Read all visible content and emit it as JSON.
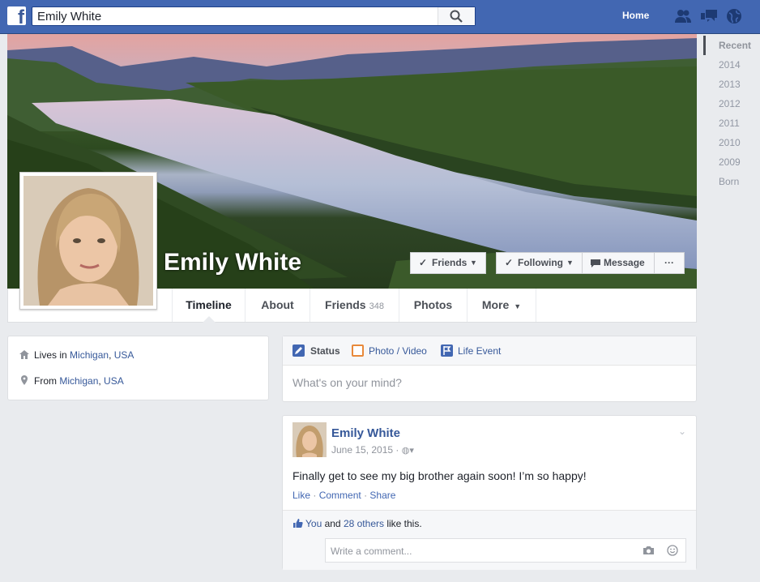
{
  "header": {
    "search_value": "Emily White",
    "home_label": "Home"
  },
  "timeline_nav": [
    "Recent",
    "2014",
    "2013",
    "2012",
    "2011",
    "2010",
    "2009",
    "Born"
  ],
  "profile": {
    "name": "Emily White"
  },
  "cover_buttons": {
    "friends": "Friends",
    "following": "Following",
    "message": "Message",
    "more": "···"
  },
  "tabs": {
    "timeline": "Timeline",
    "about": "About",
    "friends": "Friends",
    "friends_count": "348",
    "photos": "Photos",
    "more": "More"
  },
  "intro": {
    "lives_prefix": "Lives in ",
    "lives_city": "Michigan",
    "lives_sep": ", ",
    "lives_country": "USA",
    "from_prefix": "From ",
    "from_city": "Michigan",
    "from_sep": ", ",
    "from_country": "USA"
  },
  "composer": {
    "status": "Status",
    "photo_video": "Photo / Video",
    "life_event": "Life Event",
    "placeholder": "What's on your mind?"
  },
  "post": {
    "author": "Emily White",
    "date": "June 15, 2015 ·",
    "text": "Finally get to see my big brother again soon! I’m so happy!",
    "like": "Like",
    "comment": "Comment",
    "share": "Share",
    "likes_you": "You",
    "likes_and": " and ",
    "likes_others": "28 others",
    "likes_suffix": " like this.",
    "comment_placeholder": "Write a comment..."
  },
  "colors": {
    "brand": "#4267b2",
    "link": "#365899"
  }
}
